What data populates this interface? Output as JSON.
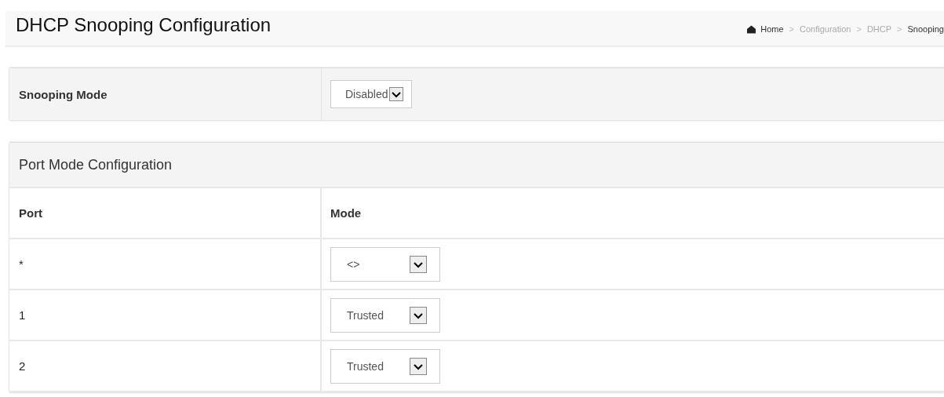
{
  "page": {
    "title": "DHCP Snooping Configuration"
  },
  "breadcrumb": [
    {
      "label": "Home",
      "kind": "home"
    },
    {
      "separator": ">",
      "label": "Configuration",
      "kind": "link"
    },
    {
      "separator": ">",
      "label": "DHCP",
      "kind": "link"
    },
    {
      "separator": ">",
      "label": "Snooping",
      "kind": "current"
    }
  ],
  "snooping_mode": {
    "label": "Snooping Mode",
    "value": "Disabled"
  },
  "port_mode": {
    "title": "Port Mode Configuration",
    "columns": [
      "Port",
      "Mode"
    ],
    "rows": [
      {
        "port": "*",
        "mode": "<>"
      },
      {
        "port": "1",
        "mode": "Trusted"
      },
      {
        "port": "2",
        "mode": "Trusted"
      }
    ]
  }
}
